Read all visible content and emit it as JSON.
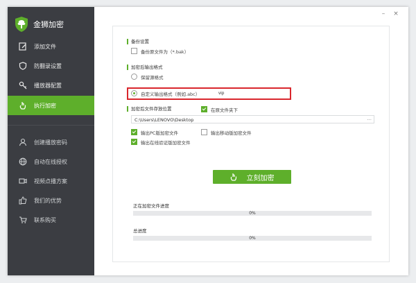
{
  "app": {
    "name": "金狮加密"
  },
  "window": {
    "minimize": "–",
    "close": "×"
  },
  "sidebar": {
    "items": [
      {
        "label": "添加文件",
        "icon": "edit-icon"
      },
      {
        "label": "防翻录设置",
        "icon": "shield-icon"
      },
      {
        "label": "播放器配置",
        "icon": "key-icon"
      },
      {
        "label": "执行加密",
        "icon": "hand-pointer-icon",
        "active": true
      }
    ],
    "sub_items": [
      {
        "label": "创建播放密码",
        "icon": "user-icon"
      },
      {
        "label": "自动在线授权",
        "icon": "globe-icon"
      },
      {
        "label": "视频点播方案",
        "icon": "video-icon"
      },
      {
        "label": "我们的优势",
        "icon": "thumbs-up-icon"
      },
      {
        "label": "联系购买",
        "icon": "cart-icon"
      }
    ]
  },
  "backup": {
    "title": "备份设置",
    "option_label": "备份原文件为（*.bak）",
    "checked": false
  },
  "output_format": {
    "title": "加密后输出格式",
    "keep_label": "保留源格式",
    "custom_label": "自定义输出格式（例如.abc）",
    "custom_value": "vip",
    "selected": "custom"
  },
  "save_location": {
    "title": "加密后文件存放位置",
    "in_source_label": "在原文件夹下",
    "in_source_checked": true,
    "path": "C:\\Users\\LENOVO\\Desktop",
    "browse": "···",
    "out_pc_label": "输出PC版加密文件",
    "out_pc_checked": true,
    "out_mobile_label": "输出移动版加密文件",
    "out_mobile_checked": false,
    "out_online_label": "输出在线验证版加密文件",
    "out_online_checked": true
  },
  "action": {
    "encrypt_label": "立刻加密"
  },
  "progress": {
    "current_label": "正在加密文件进度",
    "current_value": "0%",
    "current_fraction": 0,
    "total_label": "总进度",
    "total_value": "0%",
    "total_fraction": 0
  },
  "colors": {
    "accent": "#5eaf2b",
    "sidebar": "#3b3d42",
    "highlight": "#d9262c"
  }
}
